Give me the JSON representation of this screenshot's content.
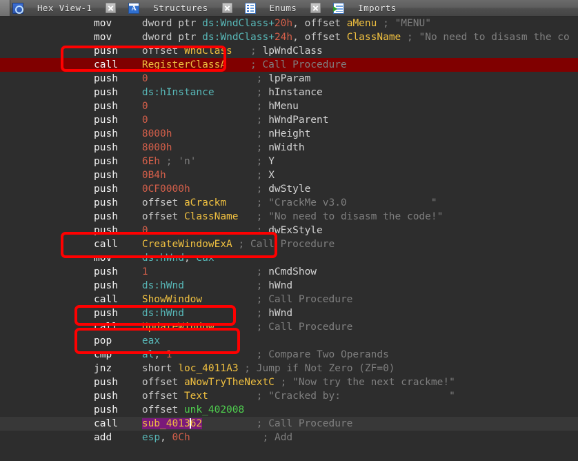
{
  "window": {
    "title": "Hex View-1"
  },
  "tabbar": {
    "tabs": [
      {
        "label": "Hex View-1",
        "icon": "hex-view-icon",
        "closable": true
      },
      {
        "label": "Structures",
        "icon": "structures-icon",
        "closable": true
      },
      {
        "label": "Enums",
        "icon": "enums-icon",
        "closable": true
      },
      {
        "label": "Imports",
        "icon": "imports-icon",
        "closable": false
      }
    ]
  },
  "colors": {
    "background": "#2d2d2d",
    "highlight_row": "#800000",
    "current_row": "#383838",
    "annotation": "#ff0000",
    "selection": "#7a1a7a",
    "symbol": "#f0c040",
    "register": "#58b8b8",
    "number": "#d45f4a",
    "comment": "#7f7f7f"
  },
  "disassembly": {
    "lines": [
      {
        "mnemonic": "mov",
        "operands": "dword ptr ds:WndClass+20h, offset aMenu",
        "comment": "; \"MENU\"",
        "highlight": "none"
      },
      {
        "mnemonic": "mov",
        "operands": "dword ptr ds:WndClass+24h, offset ClassName",
        "comment": "; \"No need to disasm the co",
        "highlight": "none"
      },
      {
        "mnemonic": "push",
        "operands": "offset WndClass",
        "comment": "; lpWndClass",
        "highlight": "none"
      },
      {
        "mnemonic": "call",
        "operands": "RegisterClassA",
        "comment": "; Call Procedure",
        "highlight": "red-row"
      },
      {
        "mnemonic": "push",
        "operands": "0",
        "comment": "; lpParam",
        "highlight": "none"
      },
      {
        "mnemonic": "push",
        "operands": "ds:hInstance",
        "comment": "; hInstance",
        "highlight": "none"
      },
      {
        "mnemonic": "push",
        "operands": "0",
        "comment": "; hMenu",
        "highlight": "none"
      },
      {
        "mnemonic": "push",
        "operands": "0",
        "comment": "; hWndParent",
        "highlight": "none"
      },
      {
        "mnemonic": "push",
        "operands": "8000h",
        "comment": "; nHeight",
        "highlight": "none"
      },
      {
        "mnemonic": "push",
        "operands": "8000h",
        "comment": "; nWidth",
        "highlight": "none"
      },
      {
        "mnemonic": "push",
        "operands": "6Eh ; 'n'",
        "comment": "; Y",
        "highlight": "none"
      },
      {
        "mnemonic": "push",
        "operands": "0B4h",
        "comment": "; X",
        "highlight": "none"
      },
      {
        "mnemonic": "push",
        "operands": "0CF0000h",
        "comment": "; dwStyle",
        "highlight": "none"
      },
      {
        "mnemonic": "push",
        "operands": "offset aCrackm",
        "comment": "; \"CrackMe v3.0              \"",
        "highlight": "none"
      },
      {
        "mnemonic": "push",
        "operands": "offset ClassName",
        "comment": "; \"No need to disasm the code!\"",
        "highlight": "none"
      },
      {
        "mnemonic": "push",
        "operands": "0",
        "comment": "; dwExStyle",
        "highlight": "none"
      },
      {
        "mnemonic": "call",
        "operands": "CreateWindowExA",
        "comment": "; Call Procedure",
        "highlight": "none"
      },
      {
        "mnemonic": "mov",
        "operands": "ds:hWnd, eax",
        "comment": "",
        "highlight": "none"
      },
      {
        "mnemonic": "push",
        "operands": "1",
        "comment": "; nCmdShow",
        "highlight": "none"
      },
      {
        "mnemonic": "push",
        "operands": "ds:hWnd",
        "comment": "; hWnd",
        "highlight": "none"
      },
      {
        "mnemonic": "call",
        "operands": "ShowWindow",
        "comment": "; Call Procedure",
        "highlight": "none"
      },
      {
        "mnemonic": "push",
        "operands": "ds:hWnd",
        "comment": "; hWnd",
        "highlight": "none"
      },
      {
        "mnemonic": "call",
        "operands": "UpdateWindow",
        "comment": "; Call Procedure",
        "highlight": "none"
      },
      {
        "mnemonic": "pop",
        "operands": "eax",
        "comment": "",
        "highlight": "none"
      },
      {
        "mnemonic": "cmp",
        "operands": "al, 1",
        "comment": "; Compare Two Operands",
        "highlight": "none"
      },
      {
        "mnemonic": "jnz",
        "operands": "short loc_4011A3",
        "comment": "; Jump if Not Zero (ZF=0)",
        "highlight": "none"
      },
      {
        "mnemonic": "push",
        "operands": "offset aNowTryTheNextC",
        "comment": "; \"Now try the next crackme!\"",
        "highlight": "none"
      },
      {
        "mnemonic": "push",
        "operands": "offset Text",
        "comment": "; \"Cracked by:                  \"",
        "highlight": "none"
      },
      {
        "mnemonic": "push",
        "operands": "offset unk_402008",
        "comment": "",
        "highlight": "none"
      },
      {
        "mnemonic": "call",
        "operands": "sub_401362",
        "comment": "; Call Procedure",
        "highlight": "current-row"
      },
      {
        "mnemonic": "add",
        "operands": "esp, 0Ch",
        "comment": "; Add",
        "highlight": "none"
      }
    ],
    "selected_token": "sub_401362",
    "annotations": [
      {
        "target": "RegisterClassA",
        "label": "annotation-box-registerclassa"
      },
      {
        "target": "CreateWindowExA",
        "label": "annotation-box-createwindowexa"
      },
      {
        "target": "ShowWindow",
        "label": "annotation-box-showwindow"
      },
      {
        "target": "UpdateWindow",
        "label": "annotation-box-updatewindow"
      }
    ]
  }
}
